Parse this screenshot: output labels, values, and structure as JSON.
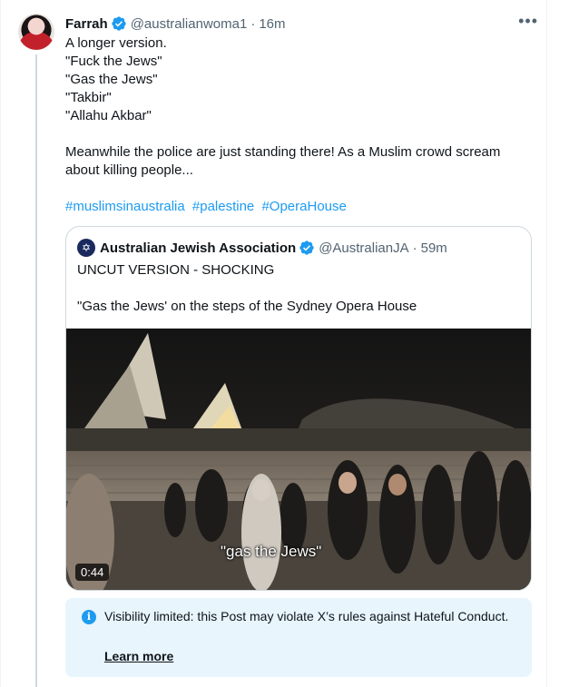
{
  "tweet": {
    "author_name": "Farrah",
    "author_handle": "@australianwoma1",
    "time": "16m",
    "dot": "·",
    "more_label": "•••",
    "text": "A longer version.\n\"Fuck the Jews\"\n\"Gas the Jews\"\n\"Takbir\"\n\"Allahu Akbar\"\n\nMeanwhile the police are just standing there! As a Muslim crowd scream\nabout killing people...",
    "hashtags": [
      "#muslimsinaustralia",
      "#palestine",
      "#OperaHouse"
    ]
  },
  "quote": {
    "author_name": "Australian Jewish Association",
    "author_handle": "@AustralianJA",
    "time": "59m",
    "dot": "·",
    "avatar_symbol": "✡",
    "text": "UNCUT VERSION - SHOCKING\n\n\"Gas the Jews' on the steps of the Sydney Opera House",
    "video": {
      "duration": "0:44",
      "caption": "\"gas the Jews\""
    }
  },
  "notice": {
    "text": "Visibility limited: this Post may violate X’s rules against Hateful Conduct.",
    "link": "Learn more",
    "icon_glyph": "i"
  },
  "colors": {
    "accent": "#1d9bf0",
    "verified": "#1d9bf0",
    "notice_bg": "#e8f5fd"
  }
}
